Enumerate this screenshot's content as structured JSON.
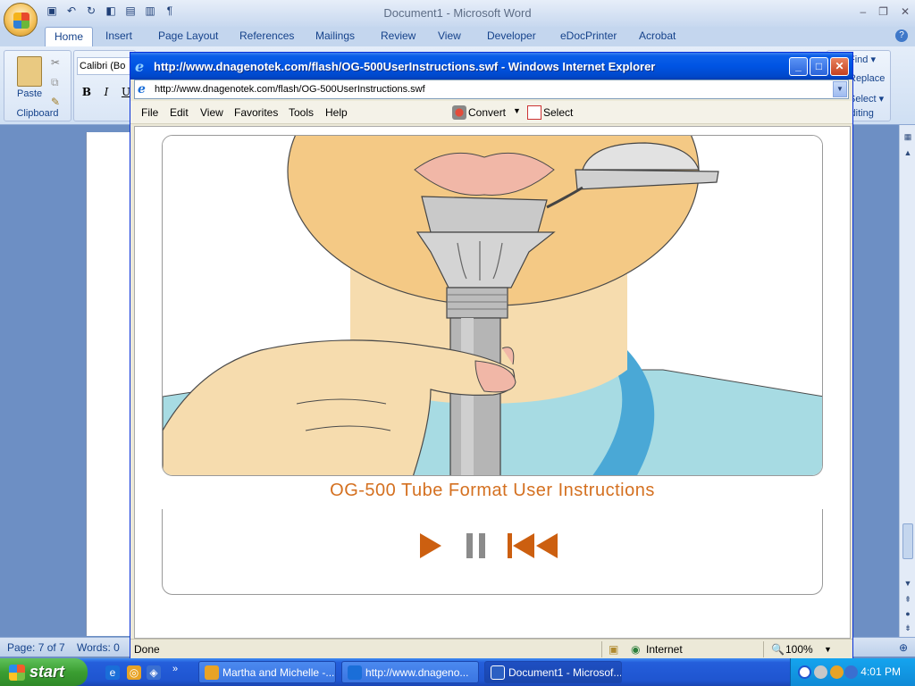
{
  "word": {
    "title": "Document1 - Microsoft Word",
    "window_controls": {
      "minimize": "–",
      "restore": "❐",
      "close": "✕"
    },
    "tabs": [
      "Home",
      "Insert",
      "Page Layout",
      "References",
      "Mailings",
      "Review",
      "View",
      "Developer",
      "eDocPrinter",
      "Acrobat"
    ],
    "active_tab": "Home",
    "ribbon": {
      "paste_label": "Paste",
      "clipboard_label": "Clipboard",
      "font_name": "Calibri (Bo",
      "bold": "B",
      "italic": "I",
      "underline": "U",
      "editing": {
        "find": "Find ▾",
        "replace": "Replace",
        "select": "Select ▾",
        "label": "Editing"
      }
    },
    "status": {
      "page": "Page: 7 of 7",
      "words": "Words: 0"
    }
  },
  "ie": {
    "title": "http://www.dnagenotek.com/flash/OG-500UserInstructions.swf - Windows Internet Explorer",
    "address": "http://www.dnagenotek.com/flash/OG-500UserInstructions.swf",
    "menu": [
      "File",
      "Edit",
      "View",
      "Favorites",
      "Tools",
      "Help"
    ],
    "convert_label": "Convert",
    "select_label": "Select",
    "content": {
      "title": "OG-500 Tube Format User Instructions",
      "controls": [
        "play",
        "pause",
        "rewind"
      ]
    },
    "status": {
      "text": "Done",
      "zone": "Internet",
      "zoom": "100%"
    }
  },
  "taskbar": {
    "start_label": "start",
    "buttons": [
      {
        "label": "Martha and Michelle -...",
        "icon": "outlook-icon"
      },
      {
        "label": "http://www.dnageno...",
        "icon": "ie-icon"
      },
      {
        "label": "Document1 - Microsof...",
        "icon": "word-icon"
      }
    ],
    "clock": "4:01 PM"
  },
  "colors": {
    "ie_title_blue": "#0054e3",
    "flash_title_orange": "#d47020",
    "control_orange": "#cc5f10",
    "taskbar_blue": "#245edb"
  }
}
